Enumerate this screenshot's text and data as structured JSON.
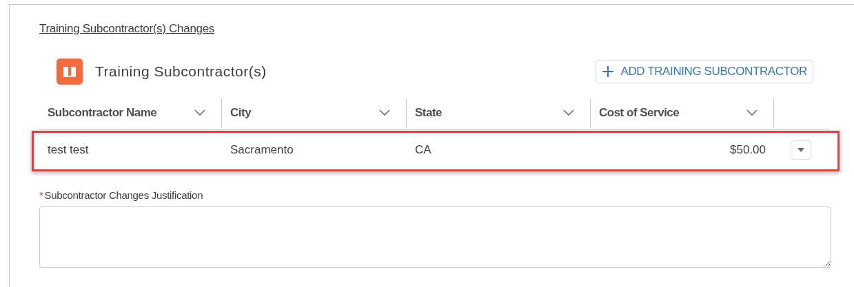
{
  "section_title": "Training Subcontractor(s) Changes",
  "card": {
    "title": "Training Subcontractor(s)",
    "add_button": "ADD TRAINING SUBCONTRACTOR"
  },
  "table": {
    "columns": [
      {
        "label": "Subcontractor Name"
      },
      {
        "label": "City"
      },
      {
        "label": "State"
      },
      {
        "label": "Cost of Service"
      }
    ],
    "rows": [
      {
        "cells": [
          "test test",
          "Sacramento",
          "CA",
          "$50.00"
        ],
        "highlighted": true
      }
    ]
  },
  "justification": {
    "label": "Subcontractor Changes Justification",
    "required": true,
    "marker": "*"
  }
}
